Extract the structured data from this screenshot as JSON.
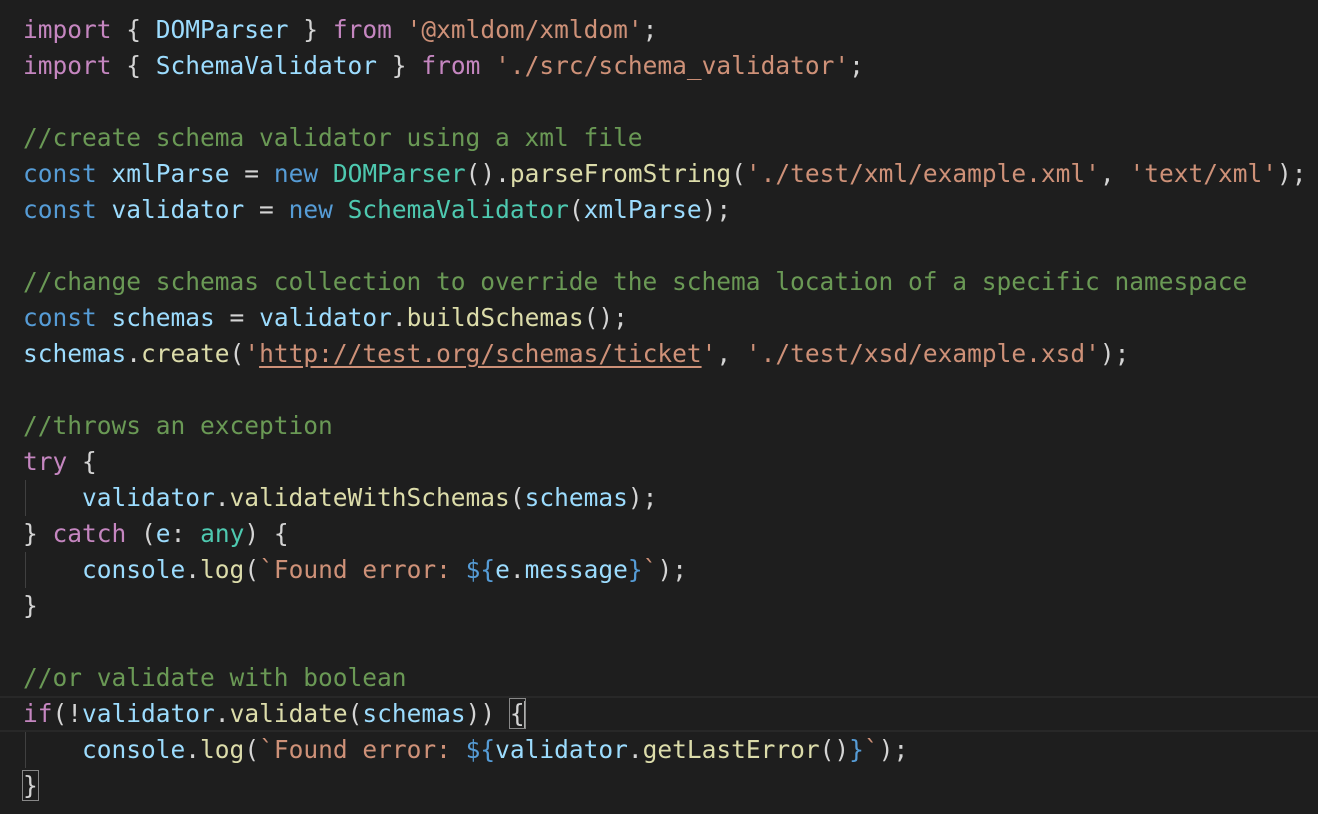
{
  "editor": {
    "lines": [
      [
        {
          "t": "import",
          "c": "kw"
        },
        {
          "t": " { ",
          "c": "punc"
        },
        {
          "t": "DOMParser",
          "c": "var"
        },
        {
          "t": " } ",
          "c": "punc"
        },
        {
          "t": "from",
          "c": "kw"
        },
        {
          "t": " ",
          "c": "punc"
        },
        {
          "t": "'@xmldom/xmldom'",
          "c": "str"
        },
        {
          "t": ";",
          "c": "punc"
        }
      ],
      [
        {
          "t": "import",
          "c": "kw"
        },
        {
          "t": " { ",
          "c": "punc"
        },
        {
          "t": "SchemaValidator",
          "c": "var"
        },
        {
          "t": " } ",
          "c": "punc"
        },
        {
          "t": "from",
          "c": "kw"
        },
        {
          "t": " ",
          "c": "punc"
        },
        {
          "t": "'./src/schema_validator'",
          "c": "str"
        },
        {
          "t": ";",
          "c": "punc"
        }
      ],
      [],
      [
        {
          "t": "//create schema validator using a xml file",
          "c": "cmt"
        }
      ],
      [
        {
          "t": "const",
          "c": "decl"
        },
        {
          "t": " ",
          "c": "punc"
        },
        {
          "t": "xmlParse",
          "c": "var"
        },
        {
          "t": " = ",
          "c": "punc"
        },
        {
          "t": "new",
          "c": "decl"
        },
        {
          "t": " ",
          "c": "punc"
        },
        {
          "t": "DOMParser",
          "c": "cls"
        },
        {
          "t": "().",
          "c": "punc"
        },
        {
          "t": "parseFromString",
          "c": "fn"
        },
        {
          "t": "(",
          "c": "punc"
        },
        {
          "t": "'./test/xml/example.xml'",
          "c": "str"
        },
        {
          "t": ", ",
          "c": "punc"
        },
        {
          "t": "'text/xml'",
          "c": "str"
        },
        {
          "t": ");",
          "c": "punc"
        }
      ],
      [
        {
          "t": "const",
          "c": "decl"
        },
        {
          "t": " ",
          "c": "punc"
        },
        {
          "t": "validator",
          "c": "var"
        },
        {
          "t": " = ",
          "c": "punc"
        },
        {
          "t": "new",
          "c": "decl"
        },
        {
          "t": " ",
          "c": "punc"
        },
        {
          "t": "SchemaValidator",
          "c": "cls"
        },
        {
          "t": "(",
          "c": "punc"
        },
        {
          "t": "xmlParse",
          "c": "var"
        },
        {
          "t": ");",
          "c": "punc"
        }
      ],
      [],
      [
        {
          "t": "//change schemas collection to override the schema location of a specific namespace",
          "c": "cmt"
        }
      ],
      [
        {
          "t": "const",
          "c": "decl"
        },
        {
          "t": " ",
          "c": "punc"
        },
        {
          "t": "schemas",
          "c": "var"
        },
        {
          "t": " = ",
          "c": "punc"
        },
        {
          "t": "validator",
          "c": "var"
        },
        {
          "t": ".",
          "c": "punc"
        },
        {
          "t": "buildSchemas",
          "c": "fn"
        },
        {
          "t": "();",
          "c": "punc"
        }
      ],
      [
        {
          "t": "schemas",
          "c": "var"
        },
        {
          "t": ".",
          "c": "punc"
        },
        {
          "t": "create",
          "c": "fn"
        },
        {
          "t": "(",
          "c": "punc"
        },
        {
          "t": "'",
          "c": "str"
        },
        {
          "t": "http://test.org/schemas/ticket",
          "c": "link"
        },
        {
          "t": "'",
          "c": "str"
        },
        {
          "t": ", ",
          "c": "punc"
        },
        {
          "t": "'./test/xsd/example.xsd'",
          "c": "str"
        },
        {
          "t": ");",
          "c": "punc"
        }
      ],
      [],
      [
        {
          "t": "//throws an exception",
          "c": "cmt"
        }
      ],
      [
        {
          "t": "try",
          "c": "kw"
        },
        {
          "t": " {",
          "c": "punc"
        }
      ],
      [
        {
          "t": "    ",
          "c": "punc"
        },
        {
          "t": "validator",
          "c": "var"
        },
        {
          "t": ".",
          "c": "punc"
        },
        {
          "t": "validateWithSchemas",
          "c": "fn"
        },
        {
          "t": "(",
          "c": "punc"
        },
        {
          "t": "schemas",
          "c": "var"
        },
        {
          "t": ");",
          "c": "punc"
        }
      ],
      [
        {
          "t": "} ",
          "c": "punc"
        },
        {
          "t": "catch",
          "c": "kw"
        },
        {
          "t": " (",
          "c": "punc"
        },
        {
          "t": "e",
          "c": "var"
        },
        {
          "t": ": ",
          "c": "punc"
        },
        {
          "t": "any",
          "c": "cls"
        },
        {
          "t": ") {",
          "c": "punc"
        }
      ],
      [
        {
          "t": "    ",
          "c": "punc"
        },
        {
          "t": "console",
          "c": "var"
        },
        {
          "t": ".",
          "c": "punc"
        },
        {
          "t": "log",
          "c": "fn"
        },
        {
          "t": "(",
          "c": "punc"
        },
        {
          "t": "`Found error: ",
          "c": "str"
        },
        {
          "t": "${",
          "c": "tpl"
        },
        {
          "t": "e",
          "c": "var"
        },
        {
          "t": ".",
          "c": "punc"
        },
        {
          "t": "message",
          "c": "var"
        },
        {
          "t": "}",
          "c": "tpl"
        },
        {
          "t": "`",
          "c": "str"
        },
        {
          "t": ");",
          "c": "punc"
        }
      ],
      [
        {
          "t": "}",
          "c": "punc"
        }
      ],
      [],
      [
        {
          "t": "//or validate with boolean",
          "c": "cmt"
        }
      ],
      [
        {
          "t": "if",
          "c": "kw"
        },
        {
          "t": "(!",
          "c": "punc"
        },
        {
          "t": "validator",
          "c": "var"
        },
        {
          "t": ".",
          "c": "punc"
        },
        {
          "t": "validate",
          "c": "fn"
        },
        {
          "t": "(",
          "c": "punc"
        },
        {
          "t": "schemas",
          "c": "var"
        },
        {
          "t": ")) ",
          "c": "punc"
        },
        {
          "t": "{",
          "c": "punc",
          "m": true
        },
        {
          "cursor": true
        }
      ],
      [
        {
          "t": "    ",
          "c": "punc"
        },
        {
          "t": "console",
          "c": "var"
        },
        {
          "t": ".",
          "c": "punc"
        },
        {
          "t": "log",
          "c": "fn"
        },
        {
          "t": "(",
          "c": "punc"
        },
        {
          "t": "`Found error: ",
          "c": "str"
        },
        {
          "t": "${",
          "c": "tpl"
        },
        {
          "t": "validator",
          "c": "var"
        },
        {
          "t": ".",
          "c": "punc"
        },
        {
          "t": "getLastError",
          "c": "fn"
        },
        {
          "t": "()",
          "c": "punc"
        },
        {
          "t": "}",
          "c": "tpl"
        },
        {
          "t": "`",
          "c": "str"
        },
        {
          "t": ");",
          "c": "punc"
        }
      ],
      [
        {
          "t": "}",
          "c": "punc",
          "m": true
        }
      ]
    ]
  },
  "colors": {
    "background": "#1e1e1e",
    "keyword": "#c586c0",
    "declaration": "#569cd6",
    "variable": "#9cdcfe",
    "function": "#dcdcaa",
    "class": "#4ec9b0",
    "string": "#ce9178",
    "comment": "#6a9955"
  }
}
